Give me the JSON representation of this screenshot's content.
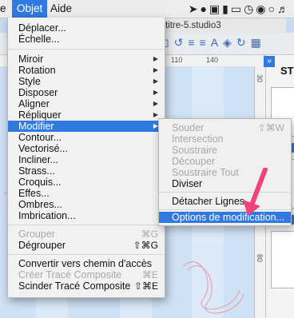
{
  "menubar": {
    "left_fragment": "e",
    "objet": "Objet",
    "aide": "Aide"
  },
  "app": {
    "doc_title": "s titre-5.studio3",
    "panel_title": "STY",
    "panel_tab": "»",
    "ruler_top": [
      "110",
      "140"
    ],
    "ruler_right": [
      "30",
      "80"
    ]
  },
  "objet_menu": {
    "items": [
      {
        "label": "Déplacer..."
      },
      {
        "label": "Échelle..."
      },
      {
        "label": "Miroir",
        "submenu": true
      },
      {
        "label": "Rotation",
        "submenu": true
      },
      {
        "label": "Style",
        "submenu": true
      },
      {
        "label": "Disposer",
        "submenu": true
      },
      {
        "label": "Aligner",
        "submenu": true
      },
      {
        "label": "Répliquer",
        "submenu": true
      },
      {
        "label": "Modifier",
        "submenu": true,
        "highlighted": true
      },
      {
        "label": "Contour..."
      },
      {
        "label": "Vectorisé..."
      },
      {
        "label": "Incliner..."
      },
      {
        "label": "Strass..."
      },
      {
        "label": "Croquis..."
      },
      {
        "label": "Effes..."
      },
      {
        "label": "Ombres..."
      },
      {
        "label": "Imbrication..."
      },
      {
        "label": "Grouper",
        "shortcut": "⌘G",
        "disabled": true
      },
      {
        "label": "Dégrouper",
        "shortcut": "⇧⌘G"
      },
      {
        "label": "Convertir vers chemin d'accès"
      },
      {
        "label": "Créer Tracé Composite",
        "shortcut": "⌘E",
        "disabled": true
      },
      {
        "label": "Scinder Tracé Composite",
        "shortcut": "⇧⌘E"
      }
    ]
  },
  "modifier_submenu": {
    "items": [
      {
        "label": "Souder",
        "shortcut": "⇧⌘W",
        "disabled": true
      },
      {
        "label": "Intersection",
        "disabled": true
      },
      {
        "label": "Soustraire",
        "disabled": true
      },
      {
        "label": "Découper",
        "disabled": true
      },
      {
        "label": "Soustraire Tout",
        "disabled": true
      },
      {
        "label": "Diviser"
      },
      {
        "label": "Détacher Lignes"
      },
      {
        "label": "Options de modification...",
        "highlighted": true
      }
    ]
  },
  "colors": {
    "highlight": "#2f79e0",
    "annotation_arrow": "#f0457a"
  }
}
